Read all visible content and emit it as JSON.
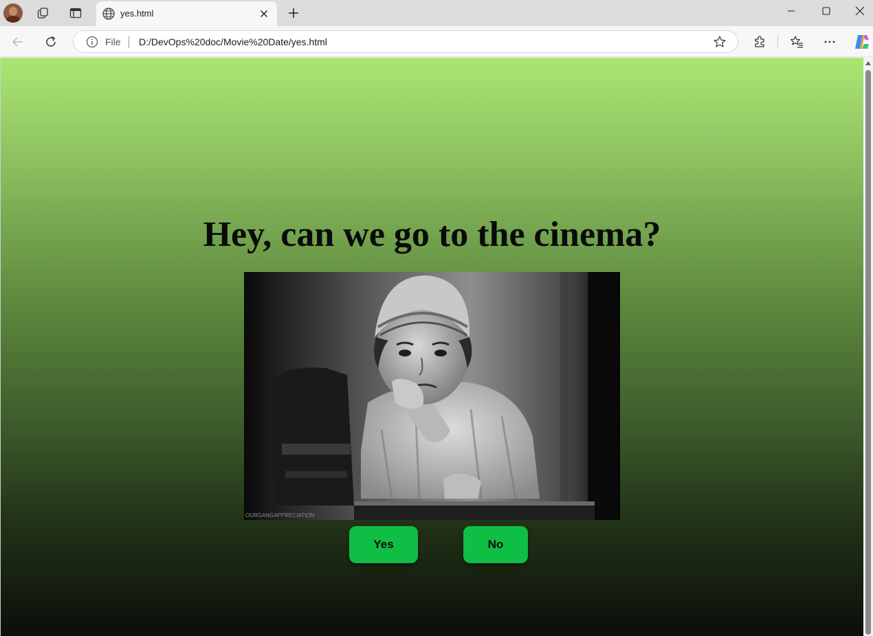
{
  "browser": {
    "tab": {
      "title": "yes.html"
    },
    "address_bar": {
      "scheme_label": "File",
      "url": "D:/DevOps%20doc/Movie%20Date/yes.html"
    }
  },
  "page": {
    "headline": "Hey, can we go to the cinema?",
    "image": {
      "watermark": "OURGANGAPPRECIATION",
      "style": "black-and-white photo of a sad child resting chin on hand"
    },
    "buttons": {
      "yes_label": "Yes",
      "no_label": "No"
    }
  },
  "colors": {
    "gradient_top": "#aae673",
    "gradient_bottom": "#0c0f0a",
    "button_green": "#0fbe44"
  },
  "icons": [
    "profile-avatar",
    "workspaces-icon",
    "vertical-tabs-icon",
    "globe-icon",
    "close-icon",
    "plus-icon",
    "minimize-icon",
    "maximize-icon",
    "window-close-icon",
    "back-icon",
    "refresh-icon",
    "info-icon",
    "star-icon",
    "extensions-icon",
    "favorites-icon",
    "more-icon",
    "copilot-icon"
  ]
}
